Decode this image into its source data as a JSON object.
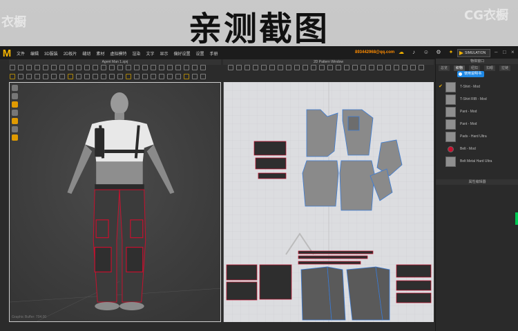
{
  "banner": {
    "title": "亲测截图",
    "watermark_left": "衣橱",
    "watermark_right": "CG衣橱"
  },
  "app": {
    "logo": "M",
    "menus": [
      "文件",
      "编辑",
      "3D服装",
      "2D板片",
      "缝纫",
      "素材",
      "虚拟模特",
      "渲染",
      "文字",
      "显示",
      "偏好设置",
      "设置",
      "手册"
    ],
    "contact": "893442968@qq.com",
    "simulation_label": "SIMULATION",
    "avatar_window_title": "Agent Man 1.zprj",
    "pattern_window_title": "2D Pattern Window",
    "object_browser_title": "物体窗口",
    "object_tabs": [
      "总览",
      "织物",
      "纽扣",
      "扣眼",
      "拉链"
    ],
    "badge": "使用说明书",
    "fabric_subpanel_title": "属性编辑器",
    "status_text": "Graphic Buffer: 704.00"
  },
  "fabrics": [
    {
      "name": "T-Shirt - Mod",
      "checked": true
    },
    {
      "name": "T-Shirt RIB - Mod",
      "checked": false
    },
    {
      "name": "Pant - Mod",
      "checked": false
    },
    {
      "name": "Pant - Mod",
      "checked": false
    },
    {
      "name": "Pads - Hard Ultra",
      "checked": false
    },
    {
      "name": "Belt - Mod",
      "checked": false
    },
    {
      "name": "Belt Metal Hard Ultra",
      "checked": false
    }
  ],
  "colors": {
    "accent": "#f5b400",
    "contact": "#ff8c00",
    "badge": "#1e88e5",
    "pattern_red": "#c8102e",
    "pattern_blue": "#3a7bd5"
  }
}
